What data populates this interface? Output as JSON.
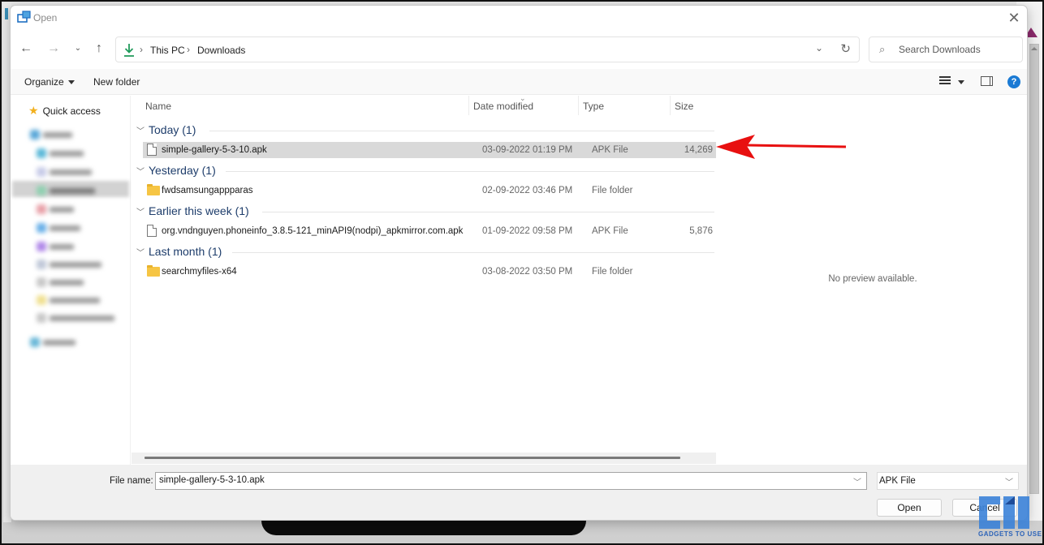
{
  "window": {
    "title": "Open",
    "close_icon": "close-icon"
  },
  "navigation": {
    "back_icon": "arrow-left-icon",
    "forward_icon": "arrow-right-icon",
    "recent_icon": "chevron-down-icon",
    "up_icon": "arrow-up-icon",
    "breadcrumb": [
      "This PC",
      "Downloads"
    ],
    "location_icon": "download-icon",
    "refresh_icon": "refresh-icon",
    "search_placeholder": "Search Downloads"
  },
  "toolbar": {
    "organize_label": "Organize",
    "new_folder_label": "New folder",
    "view_icon": "view-list-icon",
    "preview_pane_icon": "preview-pane-icon",
    "help_icon": "help-icon",
    "help_glyph": "?"
  },
  "sidebar": {
    "quick_access_label": "Quick access",
    "blurred_items_count": 13
  },
  "columns": {
    "name": "Name",
    "date_modified": "Date modified",
    "type": "Type",
    "size": "Size"
  },
  "groups": [
    {
      "label": "Today (1)",
      "files": [
        {
          "name": "simple-gallery-5-3-10.apk",
          "date": "03-09-2022 01:19 PM",
          "type": "APK File",
          "size": "14,269",
          "icon": "file-icon",
          "selected": true
        }
      ]
    },
    {
      "label": "Yesterday (1)",
      "files": [
        {
          "name": "fwdsamsungappparas",
          "date": "02-09-2022 03:46 PM",
          "type": "File folder",
          "size": "",
          "icon": "folder-icon",
          "selected": false
        }
      ]
    },
    {
      "label": "Earlier this week (1)",
      "files": [
        {
          "name": "org.vndnguyen.phoneinfo_3.8.5-121_minAPI9(nodpi)_apkmirror.com.apk",
          "date": "01-09-2022 09:58 PM",
          "type": "APK File",
          "size": "5,876",
          "icon": "file-icon",
          "selected": false
        }
      ]
    },
    {
      "label": "Last month (1)",
      "files": [
        {
          "name": "searchmyfiles-x64",
          "date": "03-08-2022 03:50 PM",
          "type": "File folder",
          "size": "",
          "icon": "folder-icon",
          "selected": false
        }
      ]
    }
  ],
  "preview": {
    "message": "No preview available."
  },
  "footer": {
    "file_name_label": "File name:",
    "file_name_value": "simple-gallery-5-3-10.apk",
    "file_type_value": "APK File",
    "open_label": "Open",
    "cancel_label": "Cancel"
  },
  "annotation": {
    "arrow_color": "#e81010",
    "points_to": "simple-gallery-5-3-10.apk"
  },
  "watermark": {
    "text": "GADGETS TO USE",
    "color": "#2c63b8"
  }
}
